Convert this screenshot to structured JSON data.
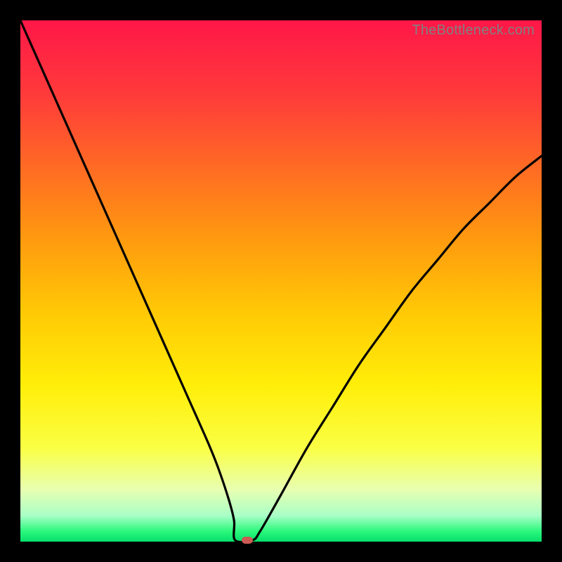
{
  "watermark": "TheBottleneck.com",
  "colors": {
    "frame": "#000000",
    "curve": "#000000",
    "marker": "#cc5a54",
    "gradient_top": "#ff1748",
    "gradient_bottom": "#05e06b"
  },
  "chart_data": {
    "type": "line",
    "title": "",
    "xlabel": "",
    "ylabel": "",
    "xlim": [
      0,
      100
    ],
    "ylim": [
      0,
      100
    ],
    "x": [
      0,
      4,
      8,
      12,
      16,
      20,
      24,
      28,
      32,
      36,
      38,
      40,
      41,
      42,
      43,
      44,
      46,
      50,
      55,
      60,
      65,
      70,
      75,
      80,
      85,
      90,
      95,
      100
    ],
    "y": [
      100,
      91,
      82,
      73,
      64,
      55,
      46,
      37,
      28,
      19,
      14,
      8,
      4,
      1,
      0,
      0,
      2,
      9,
      18,
      26,
      34,
      41,
      48,
      54,
      60,
      65,
      70,
      74
    ],
    "marker": {
      "x": 43.5,
      "y": 0
    },
    "flat_segment": {
      "x0": 41.2,
      "x1": 44.5,
      "y": 0
    }
  }
}
